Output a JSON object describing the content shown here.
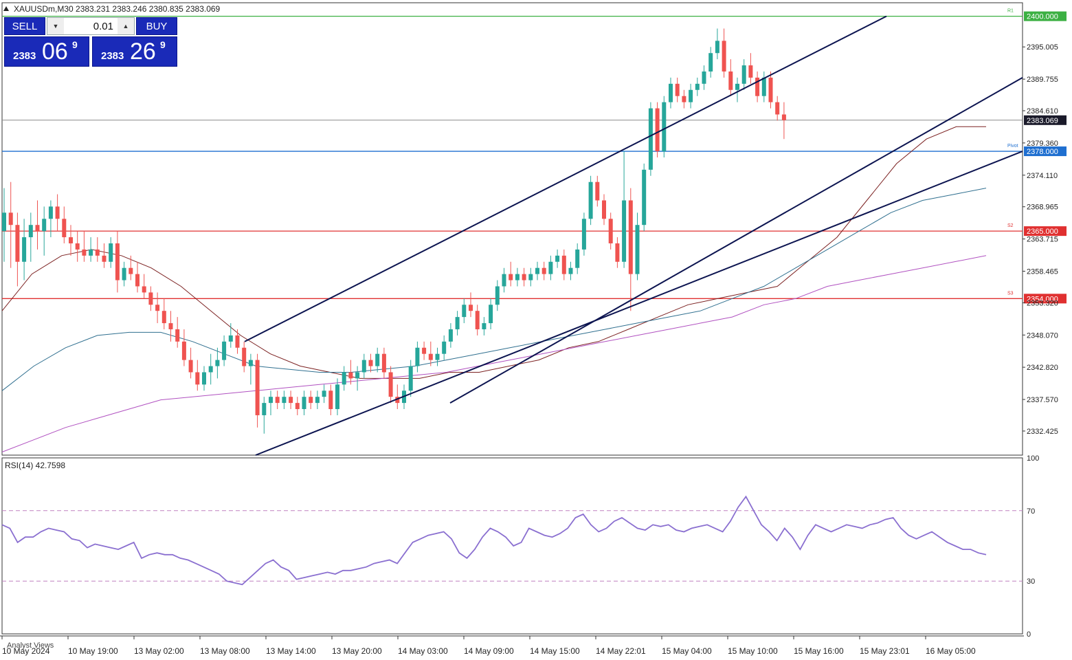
{
  "symbol_line": "XAUUSDm,M30  2383.231 2383.246 2380.835 2383.069",
  "trade_panel": {
    "sell_label": "SELL",
    "buy_label": "BUY",
    "lot": "0.01",
    "bid_prefix": "2383",
    "bid_big": "06",
    "bid_sup": "9",
    "ask_prefix": "2383",
    "ask_big": "26",
    "ask_sup": "9"
  },
  "rsi_label": "RSI(14) 42.7598",
  "analyst_views": "Analyst Views",
  "colors": {
    "bull": "#26a69a",
    "bear": "#ef5350",
    "ma_fast": "#7b2020",
    "ma_mid": "#2f6f8f",
    "ma_slow": "#b050c0",
    "channel": "#0c1450",
    "pivot": "#1f6fd0",
    "support": "#e03030",
    "resist": "#3cb043",
    "rsi": "#8a6fd0",
    "current_tag": "#1a1a2a"
  },
  "chart_data": {
    "type": "candlestick",
    "timeframe": "M30",
    "ylim": [
      2328.5,
      2402.2
    ],
    "y_ticks": [
      "2395.005",
      "2389.755",
      "2384.610",
      "2379.360",
      "2374.110",
      "2368.965",
      "2363.715",
      "2358.465",
      "2353.320",
      "2348.070",
      "2342.820",
      "2337.570",
      "2332.425"
    ],
    "x_ticks": [
      "10 May 2024",
      "10 May 19:00",
      "13 May 02:00",
      "13 May 08:00",
      "13 May 14:00",
      "13 May 20:00",
      "14 May 03:00",
      "14 May 09:00",
      "14 May 15:00",
      "14 May 22:01",
      "15 May 04:00",
      "15 May 10:00",
      "15 May 16:00",
      "15 May 23:01",
      "16 May 05:00"
    ],
    "current_price": "2383.069",
    "levels": [
      {
        "value": 2400.0,
        "label": "2400.000",
        "tag": "R1",
        "kind": "resist"
      },
      {
        "value": 2378.0,
        "label": "2378.000",
        "tag": "Pivot",
        "kind": "pivot"
      },
      {
        "value": 2365.0,
        "label": "2365.000",
        "tag": "S2",
        "kind": "support"
      },
      {
        "value": 2354.0,
        "label": "2354.000",
        "tag": "S3",
        "kind": "support"
      }
    ],
    "series": [
      {
        "name": "candles",
        "values": [
          [
            2365,
            2372,
            2360,
            2368
          ],
          [
            2368,
            2373,
            2359,
            2366
          ],
          [
            2366,
            2368,
            2356,
            2360
          ],
          [
            2360,
            2367,
            2357,
            2364
          ],
          [
            2364,
            2368,
            2360,
            2366
          ],
          [
            2366,
            2370,
            2362,
            2365
          ],
          [
            2365,
            2369,
            2361,
            2367
          ],
          [
            2367,
            2370,
            2364,
            2369
          ],
          [
            2369,
            2371,
            2365,
            2367
          ],
          [
            2367,
            2369,
            2363,
            2364
          ],
          [
            2364,
            2366,
            2361,
            2363
          ],
          [
            2363,
            2365,
            2360,
            2362
          ],
          [
            2362,
            2365,
            2360,
            2361
          ],
          [
            2361,
            2364,
            2360,
            2362
          ],
          [
            2362,
            2364,
            2360,
            2361
          ],
          [
            2361,
            2363,
            2359,
            2360
          ],
          [
            2360,
            2364,
            2359,
            2363
          ],
          [
            2363,
            2365,
            2355,
            2357
          ],
          [
            2357,
            2360,
            2356,
            2359
          ],
          [
            2359,
            2361,
            2357,
            2358
          ],
          [
            2358,
            2360,
            2355,
            2356
          ],
          [
            2356,
            2358,
            2354,
            2355
          ],
          [
            2355,
            2356,
            2352,
            2353
          ],
          [
            2353,
            2355,
            2350,
            2352
          ],
          [
            2352,
            2354,
            2349,
            2350
          ],
          [
            2350,
            2352,
            2347,
            2349
          ],
          [
            2349,
            2351,
            2346,
            2347
          ],
          [
            2347,
            2349,
            2343,
            2344
          ],
          [
            2344,
            2346,
            2341,
            2342
          ],
          [
            2342,
            2344,
            2339,
            2340
          ],
          [
            2340,
            2343,
            2339,
            2342
          ],
          [
            2342,
            2345,
            2340,
            2343
          ],
          [
            2343,
            2346,
            2341,
            2344
          ],
          [
            2344,
            2348,
            2343,
            2347
          ],
          [
            2347,
            2350,
            2346,
            2348
          ],
          [
            2348,
            2349,
            2345,
            2346
          ],
          [
            2346,
            2347,
            2342,
            2343
          ],
          [
            2343,
            2345,
            2340,
            2344
          ],
          [
            2344,
            2345,
            2333,
            2335
          ],
          [
            2335,
            2338,
            2332,
            2337
          ],
          [
            2337,
            2339,
            2335,
            2338
          ],
          [
            2338,
            2339,
            2336,
            2337
          ],
          [
            2337,
            2339,
            2336,
            2338
          ],
          [
            2338,
            2339,
            2336,
            2337
          ],
          [
            2337,
            2338,
            2335,
            2336
          ],
          [
            2336,
            2339,
            2335,
            2338
          ],
          [
            2338,
            2339,
            2336,
            2337
          ],
          [
            2337,
            2339,
            2336,
            2338
          ],
          [
            2338,
            2340,
            2337,
            2339
          ],
          [
            2339,
            2340,
            2335,
            2336
          ],
          [
            2336,
            2341,
            2335,
            2340
          ],
          [
            2340,
            2343,
            2339,
            2342
          ],
          [
            2342,
            2344,
            2340,
            2341
          ],
          [
            2341,
            2343,
            2339,
            2342
          ],
          [
            2342,
            2345,
            2341,
            2344
          ],
          [
            2344,
            2345,
            2342,
            2343
          ],
          [
            2343,
            2346,
            2342,
            2345
          ],
          [
            2345,
            2346,
            2341,
            2342
          ],
          [
            2342,
            2343,
            2337,
            2338
          ],
          [
            2338,
            2340,
            2336,
            2337
          ],
          [
            2337,
            2340,
            2336,
            2339
          ],
          [
            2339,
            2344,
            2338,
            2343
          ],
          [
            2343,
            2347,
            2342,
            2346
          ],
          [
            2346,
            2347,
            2344,
            2345
          ],
          [
            2345,
            2347,
            2343,
            2344
          ],
          [
            2344,
            2346,
            2343,
            2345
          ],
          [
            2345,
            2348,
            2344,
            2347
          ],
          [
            2347,
            2350,
            2346,
            2349
          ],
          [
            2349,
            2352,
            2348,
            2351
          ],
          [
            2351,
            2354,
            2350,
            2353
          ],
          [
            2353,
            2355,
            2351,
            2352
          ],
          [
            2352,
            2353,
            2348,
            2349
          ],
          [
            2349,
            2351,
            2348,
            2350
          ],
          [
            2350,
            2354,
            2349,
            2353
          ],
          [
            2353,
            2357,
            2352,
            2356
          ],
          [
            2356,
            2359,
            2355,
            2358
          ],
          [
            2358,
            2360,
            2356,
            2357
          ],
          [
            2357,
            2359,
            2356,
            2358
          ],
          [
            2358,
            2359,
            2356,
            2357
          ],
          [
            2357,
            2359,
            2356,
            2358
          ],
          [
            2358,
            2360,
            2357,
            2359
          ],
          [
            2359,
            2360,
            2357,
            2358
          ],
          [
            2358,
            2361,
            2357,
            2360
          ],
          [
            2360,
            2362,
            2359,
            2361
          ],
          [
            2361,
            2362,
            2357,
            2358
          ],
          [
            2358,
            2360,
            2357,
            2359
          ],
          [
            2359,
            2363,
            2358,
            2362
          ],
          [
            2362,
            2368,
            2361,
            2367
          ],
          [
            2367,
            2374,
            2366,
            2373
          ],
          [
            2373,
            2374,
            2369,
            2370
          ],
          [
            2370,
            2371,
            2366,
            2367
          ],
          [
            2367,
            2368,
            2362,
            2363
          ],
          [
            2363,
            2364,
            2359,
            2360
          ],
          [
            2360,
            2378,
            2359,
            2370
          ],
          [
            2370,
            2372,
            2352,
            2358
          ],
          [
            2358,
            2368,
            2357,
            2366
          ],
          [
            2366,
            2376,
            2365,
            2375
          ],
          [
            2375,
            2386,
            2374,
            2385
          ],
          [
            2385,
            2386,
            2377,
            2378
          ],
          [
            2378,
            2387,
            2377,
            2386
          ],
          [
            2386,
            2390,
            2385,
            2389
          ],
          [
            2389,
            2390,
            2386,
            2387
          ],
          [
            2387,
            2388,
            2385,
            2386
          ],
          [
            2386,
            2389,
            2385,
            2388
          ],
          [
            2388,
            2390,
            2387,
            2389
          ],
          [
            2389,
            2392,
            2388,
            2391
          ],
          [
            2391,
            2395,
            2390,
            2394
          ],
          [
            2394,
            2398,
            2393,
            2396
          ],
          [
            2396,
            2398,
            2390,
            2391
          ],
          [
            2391,
            2393,
            2387,
            2388
          ],
          [
            2388,
            2390,
            2386,
            2389
          ],
          [
            2389,
            2393,
            2388,
            2392
          ],
          [
            2392,
            2394,
            2389,
            2390
          ],
          [
            2390,
            2391,
            2386,
            2387
          ],
          [
            2387,
            2391,
            2386,
            2390
          ],
          [
            2390,
            2391,
            2385,
            2386
          ],
          [
            2386,
            2387,
            2383,
            2384
          ],
          [
            2384,
            2386,
            2380,
            2383.069
          ]
        ]
      },
      {
        "name": "MA fast",
        "values": [
          2352,
          2358,
          2361,
          2362,
          2361,
          2359,
          2356,
          2352,
          2348,
          2345,
          2343,
          2342,
          2341,
          2341,
          2341,
          2342,
          2342,
          2343,
          2344,
          2346,
          2347,
          2349,
          2351,
          2353,
          2354,
          2355,
          2356,
          2360,
          2364,
          2370,
          2376,
          2380,
          2382,
          2382
        ]
      },
      {
        "name": "MA mid",
        "values": [
          2339,
          2343,
          2346,
          2348,
          2348.5,
          2348.5,
          2347,
          2345,
          2343,
          2342.5,
          2342,
          2342,
          2342.5,
          2343,
          2344,
          2345,
          2346,
          2347,
          2348,
          2349,
          2350,
          2351,
          2352,
          2354,
          2356,
          2359,
          2362,
          2365,
          2368,
          2370,
          2371,
          2372
        ]
      },
      {
        "name": "MA slow",
        "values": [
          2329,
          2331,
          2333,
          2334.5,
          2336,
          2337.5,
          2338,
          2338.5,
          2339,
          2339.5,
          2340,
          2340.5,
          2341,
          2341.5,
          2342,
          2343,
          2344,
          2345,
          2346,
          2347,
          2348,
          2349,
          2350,
          2351,
          2353,
          2354,
          2356,
          2357,
          2358,
          2359,
          2360,
          2361
        ]
      },
      {
        "name": "channel",
        "values": [
          2347,
          2400,
          2337,
          2390,
          2328.5,
          2378
        ]
      }
    ],
    "rsi": {
      "ylim": [
        0,
        100
      ],
      "y_ticks": [
        "100",
        "70",
        "30",
        "0"
      ],
      "levels": [
        70,
        30
      ],
      "values": [
        62,
        60,
        52,
        55,
        55,
        58,
        60,
        59,
        58,
        54,
        53,
        49,
        51,
        50,
        49,
        48,
        50,
        52,
        43,
        45,
        46,
        45,
        45,
        43,
        42,
        40,
        38,
        36,
        34,
        30,
        29,
        28,
        32,
        36,
        40,
        42,
        38,
        36,
        31,
        32,
        33,
        34,
        35,
        34,
        36,
        36,
        37,
        38,
        40,
        41,
        42,
        40,
        46,
        52,
        54,
        56,
        57,
        58,
        54,
        46,
        43,
        48,
        55,
        60,
        58,
        55,
        50,
        52,
        60,
        58,
        56,
        55,
        57,
        60,
        66,
        68,
        62,
        58,
        60,
        64,
        66,
        63,
        60,
        59,
        62,
        61,
        62,
        59,
        58,
        60,
        61,
        62,
        60,
        58,
        64,
        72,
        78,
        70,
        62,
        58,
        53,
        60,
        55,
        48,
        56,
        62,
        60,
        58,
        60,
        62,
        61,
        60,
        62,
        63,
        65,
        66,
        60,
        56,
        54,
        56,
        58,
        55,
        52,
        50,
        48,
        48,
        46,
        45
      ]
    }
  }
}
